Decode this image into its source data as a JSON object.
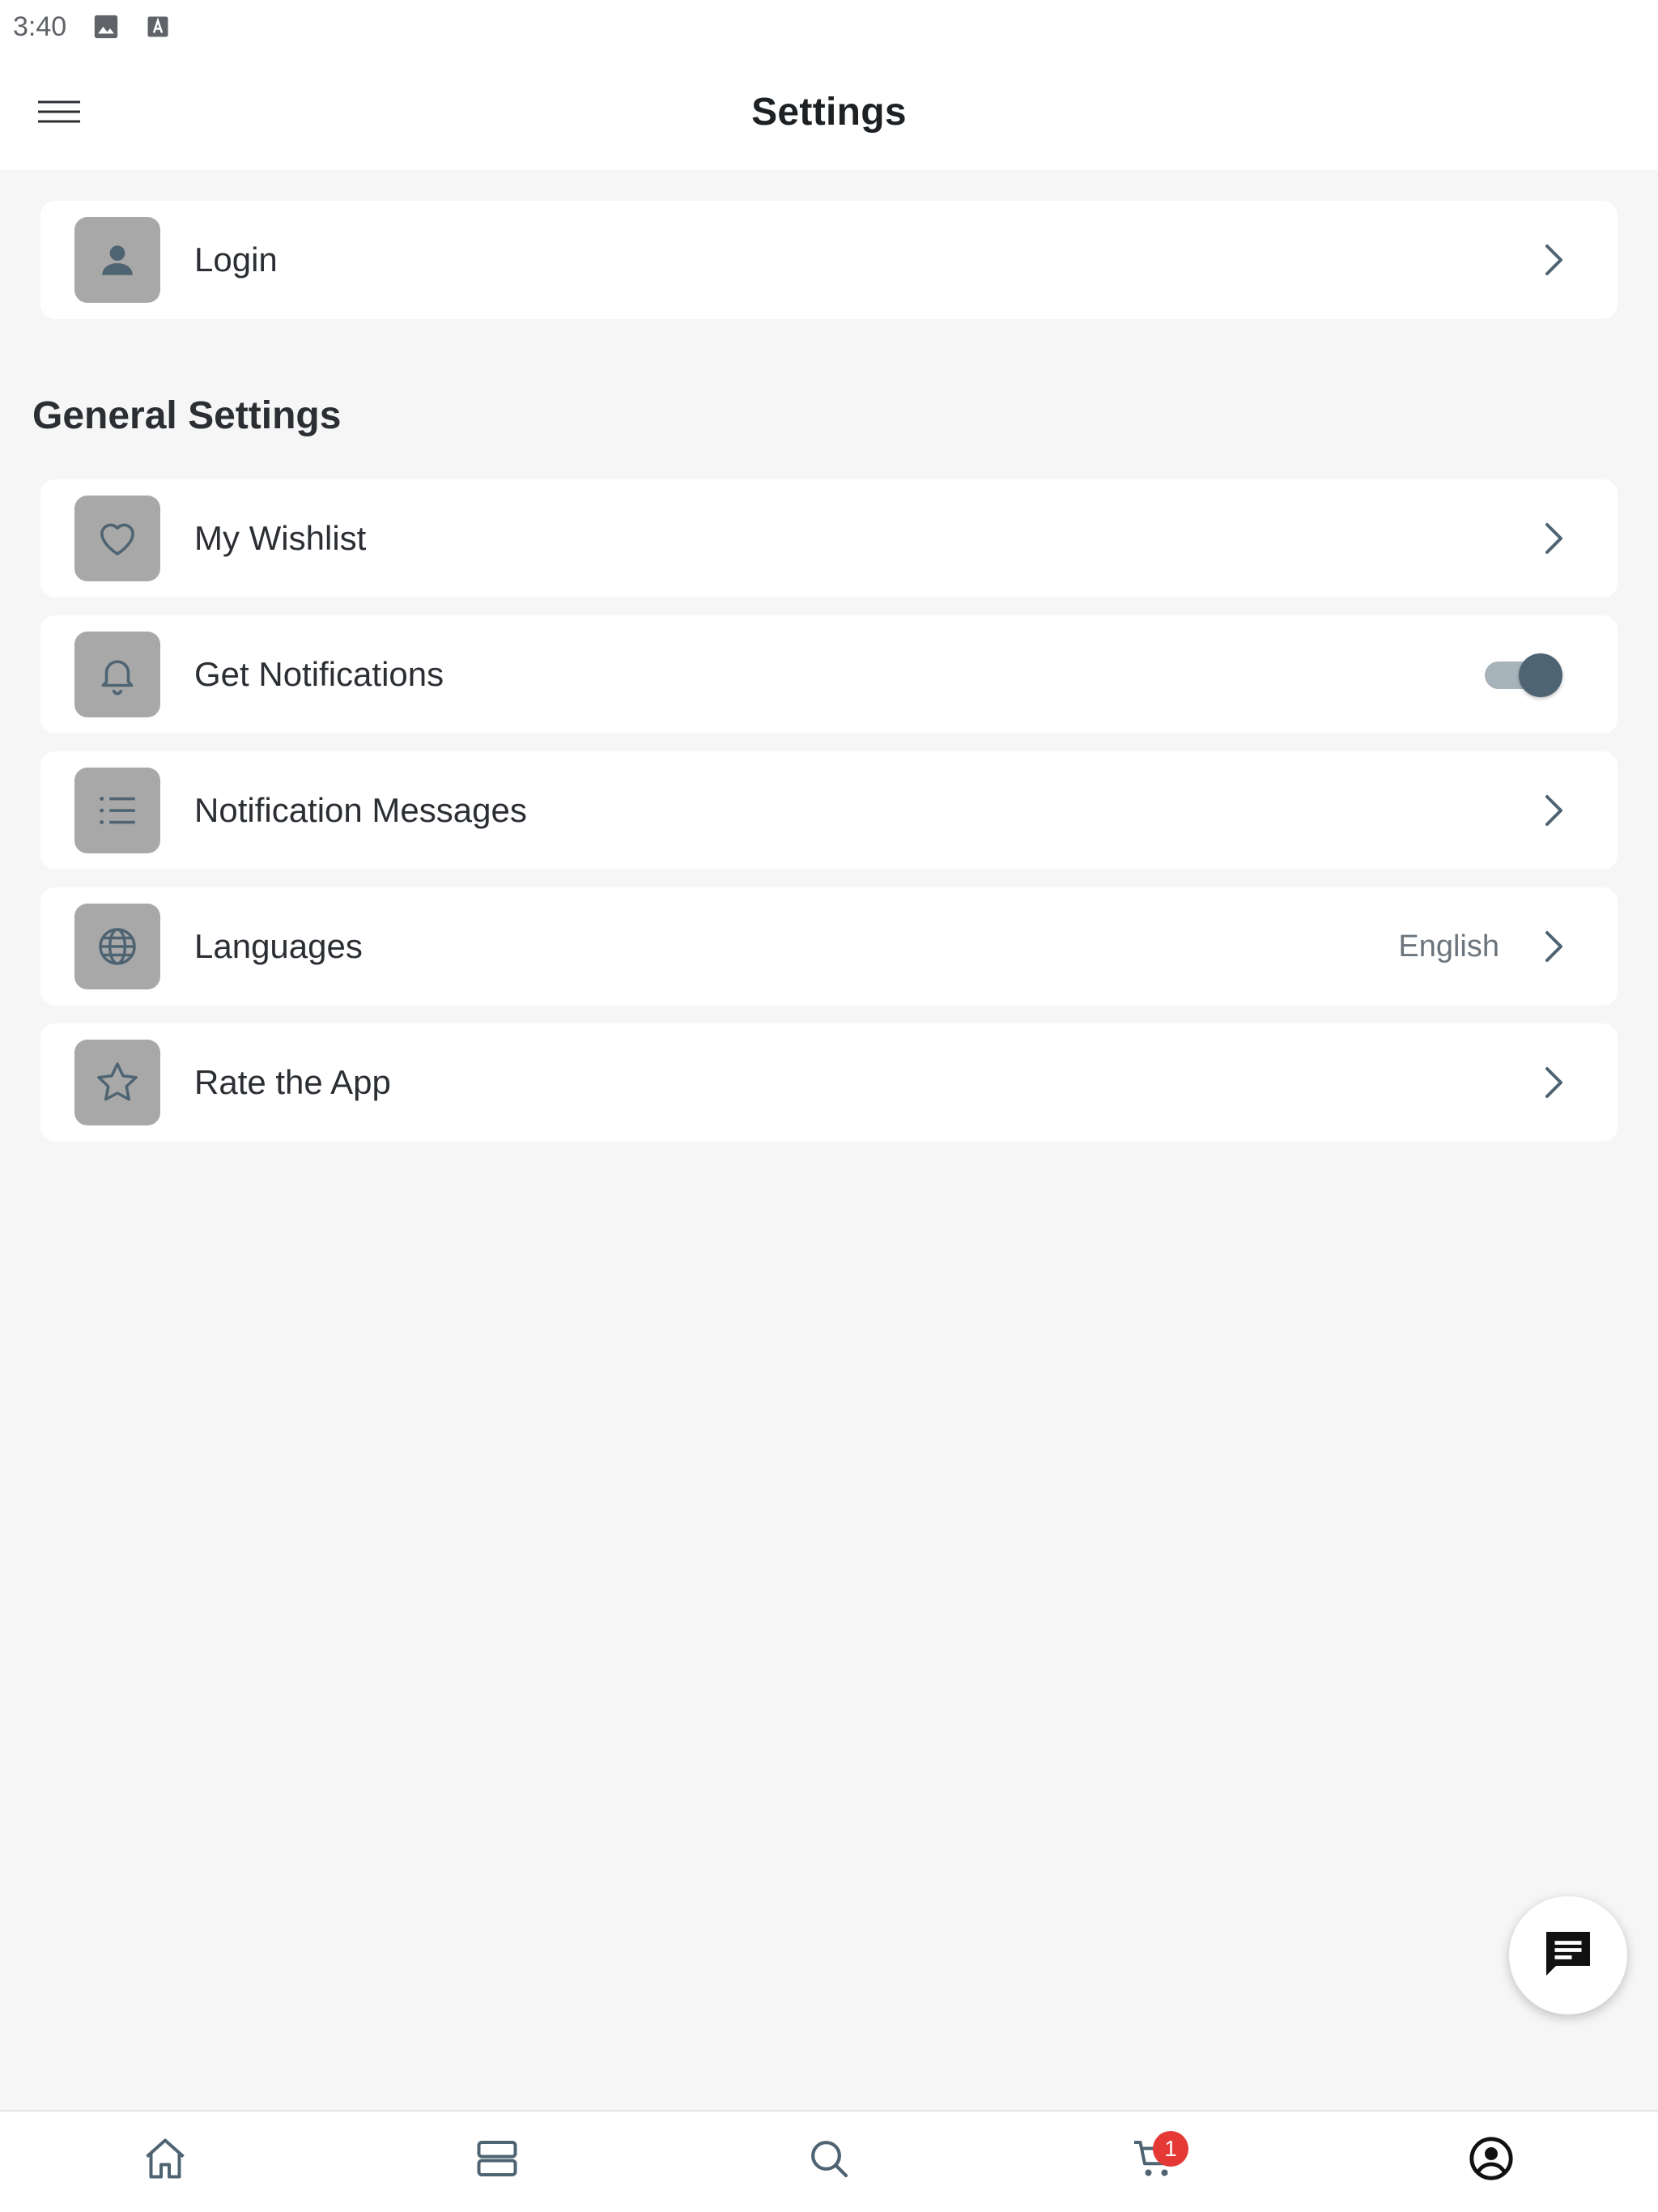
{
  "status_bar": {
    "time": "3:40",
    "icons": [
      "image-icon",
      "text-a-icon"
    ]
  },
  "header": {
    "title": "Settings",
    "menu_icon": "hamburger-menu-icon"
  },
  "login": {
    "label": "Login",
    "icon": "person-icon"
  },
  "general_settings": {
    "title": "General Settings",
    "items": [
      {
        "label": "My Wishlist",
        "icon": "heart-icon"
      },
      {
        "label": "Get Notifications",
        "icon": "bell-icon",
        "toggle_on": true
      },
      {
        "label": "Notification Messages",
        "icon": "list-icon"
      },
      {
        "label": "Languages",
        "icon": "globe-icon",
        "value": "English"
      },
      {
        "label": "Rate the App",
        "icon": "star-icon"
      }
    ]
  },
  "chat": {
    "icon": "chat-message-icon"
  },
  "bottom_nav": {
    "items": [
      {
        "icon": "home-icon"
      },
      {
        "icon": "categories-icon"
      },
      {
        "icon": "search-icon"
      },
      {
        "icon": "cart-icon"
      },
      {
        "icon": "account-icon",
        "active": true
      }
    ],
    "cart_badge": "1"
  },
  "colors": {
    "background": "#f6f6f6",
    "card": "#ffffff",
    "icon_tile": "#a8a8a8",
    "icon_stroke": "#4f6472",
    "toggle_thumb": "#4f6472",
    "badge": "#e53935"
  }
}
